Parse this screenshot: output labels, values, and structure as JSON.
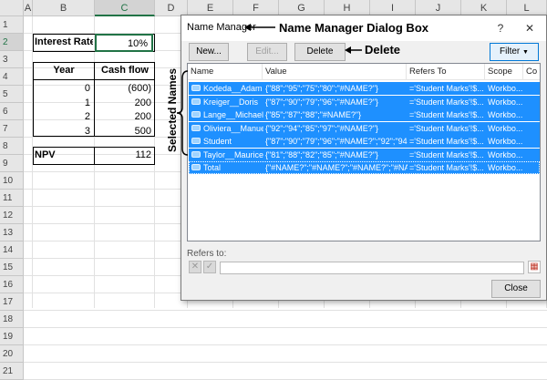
{
  "spreadsheet": {
    "columns": [
      "A",
      "B",
      "C",
      "D",
      "E",
      "F",
      "G",
      "H",
      "I",
      "J",
      "K",
      "L"
    ],
    "selected_column": "C",
    "rows": [
      "1",
      "2",
      "3",
      "4",
      "5",
      "6",
      "7",
      "8",
      "9",
      "10",
      "11",
      "12",
      "13",
      "14",
      "15",
      "16",
      "17",
      "18",
      "19",
      "20",
      "21"
    ],
    "selected_row": "2",
    "cells": {
      "interest_rate_label": "Interest Rate",
      "interest_rate_value": "10%",
      "year_header": "Year",
      "cashflow_header": "Cash flow",
      "years": [
        "0",
        "1",
        "2",
        "3"
      ],
      "cashflows": [
        "(600)",
        "200",
        "200",
        "500"
      ],
      "npv_label": "NPV",
      "npv_value": "112"
    }
  },
  "dialog": {
    "title": "Name Manager",
    "help_symbol": "?",
    "close_symbol": "✕",
    "buttons": {
      "new": "New...",
      "edit": "Edit...",
      "delete": "Delete",
      "filter": "Filter",
      "close": "Close"
    },
    "list_columns": [
      "Name",
      "Value",
      "Refers To",
      "Scope",
      "Co"
    ],
    "names": [
      {
        "name": "Kodeda__Adam",
        "value": "{\"88\";\"95\";\"75\";\"80\";\"#NAME?\"}",
        "refers_to": "='Student Marks'!$...",
        "scope": "Workbo..."
      },
      {
        "name": "Kreiger__Doris",
        "value": "{\"87\";\"90\";\"79\";\"96\";\"#NAME?\"}",
        "refers_to": "='Student Marks'!$...",
        "scope": "Workbo..."
      },
      {
        "name": "Lange__Michael",
        "value": "{\"85\";\"87\";\"88\";\"#NAME?\"}",
        "refers_to": "='Student Marks'!$...",
        "scope": "Workbo..."
      },
      {
        "name": "Oliviera__Manuel",
        "value": "{\"92\";\"94\";\"85\";\"97\";\"#NAME?\"}",
        "refers_to": "='Student Marks'!$...",
        "scope": "Workbo..."
      },
      {
        "name": "Student",
        "value": "{\"87\";\"90\";\"79\";\"96\";\"#NAME?\";\"92\";\"94\";\"...",
        "refers_to": "='Student Marks'!$...",
        "scope": "Workbo..."
      },
      {
        "name": "Taylor__Maurice",
        "value": "{\"81\";\"88\";\"82\";\"85\";\"#NAME?\"}",
        "refers_to": "='Student Marks'!$...",
        "scope": "Workbo..."
      },
      {
        "name": "Total",
        "value": "{\"#NAME?\";\"#NAME?\";\"#NAME?\";\"#NAME?\";\"#NA...",
        "refers_to": "='Student Marks'!$...",
        "scope": "Workbo..."
      }
    ],
    "refers_to_label": "Refers to:",
    "refers_to_value": ""
  },
  "annotations": {
    "dialog_box": "Name Manager Dialog Box",
    "delete": "Delete",
    "selected_names": "Selected Names"
  },
  "colors": {
    "selection": "#1e90ff",
    "excel_green": "#217346"
  }
}
